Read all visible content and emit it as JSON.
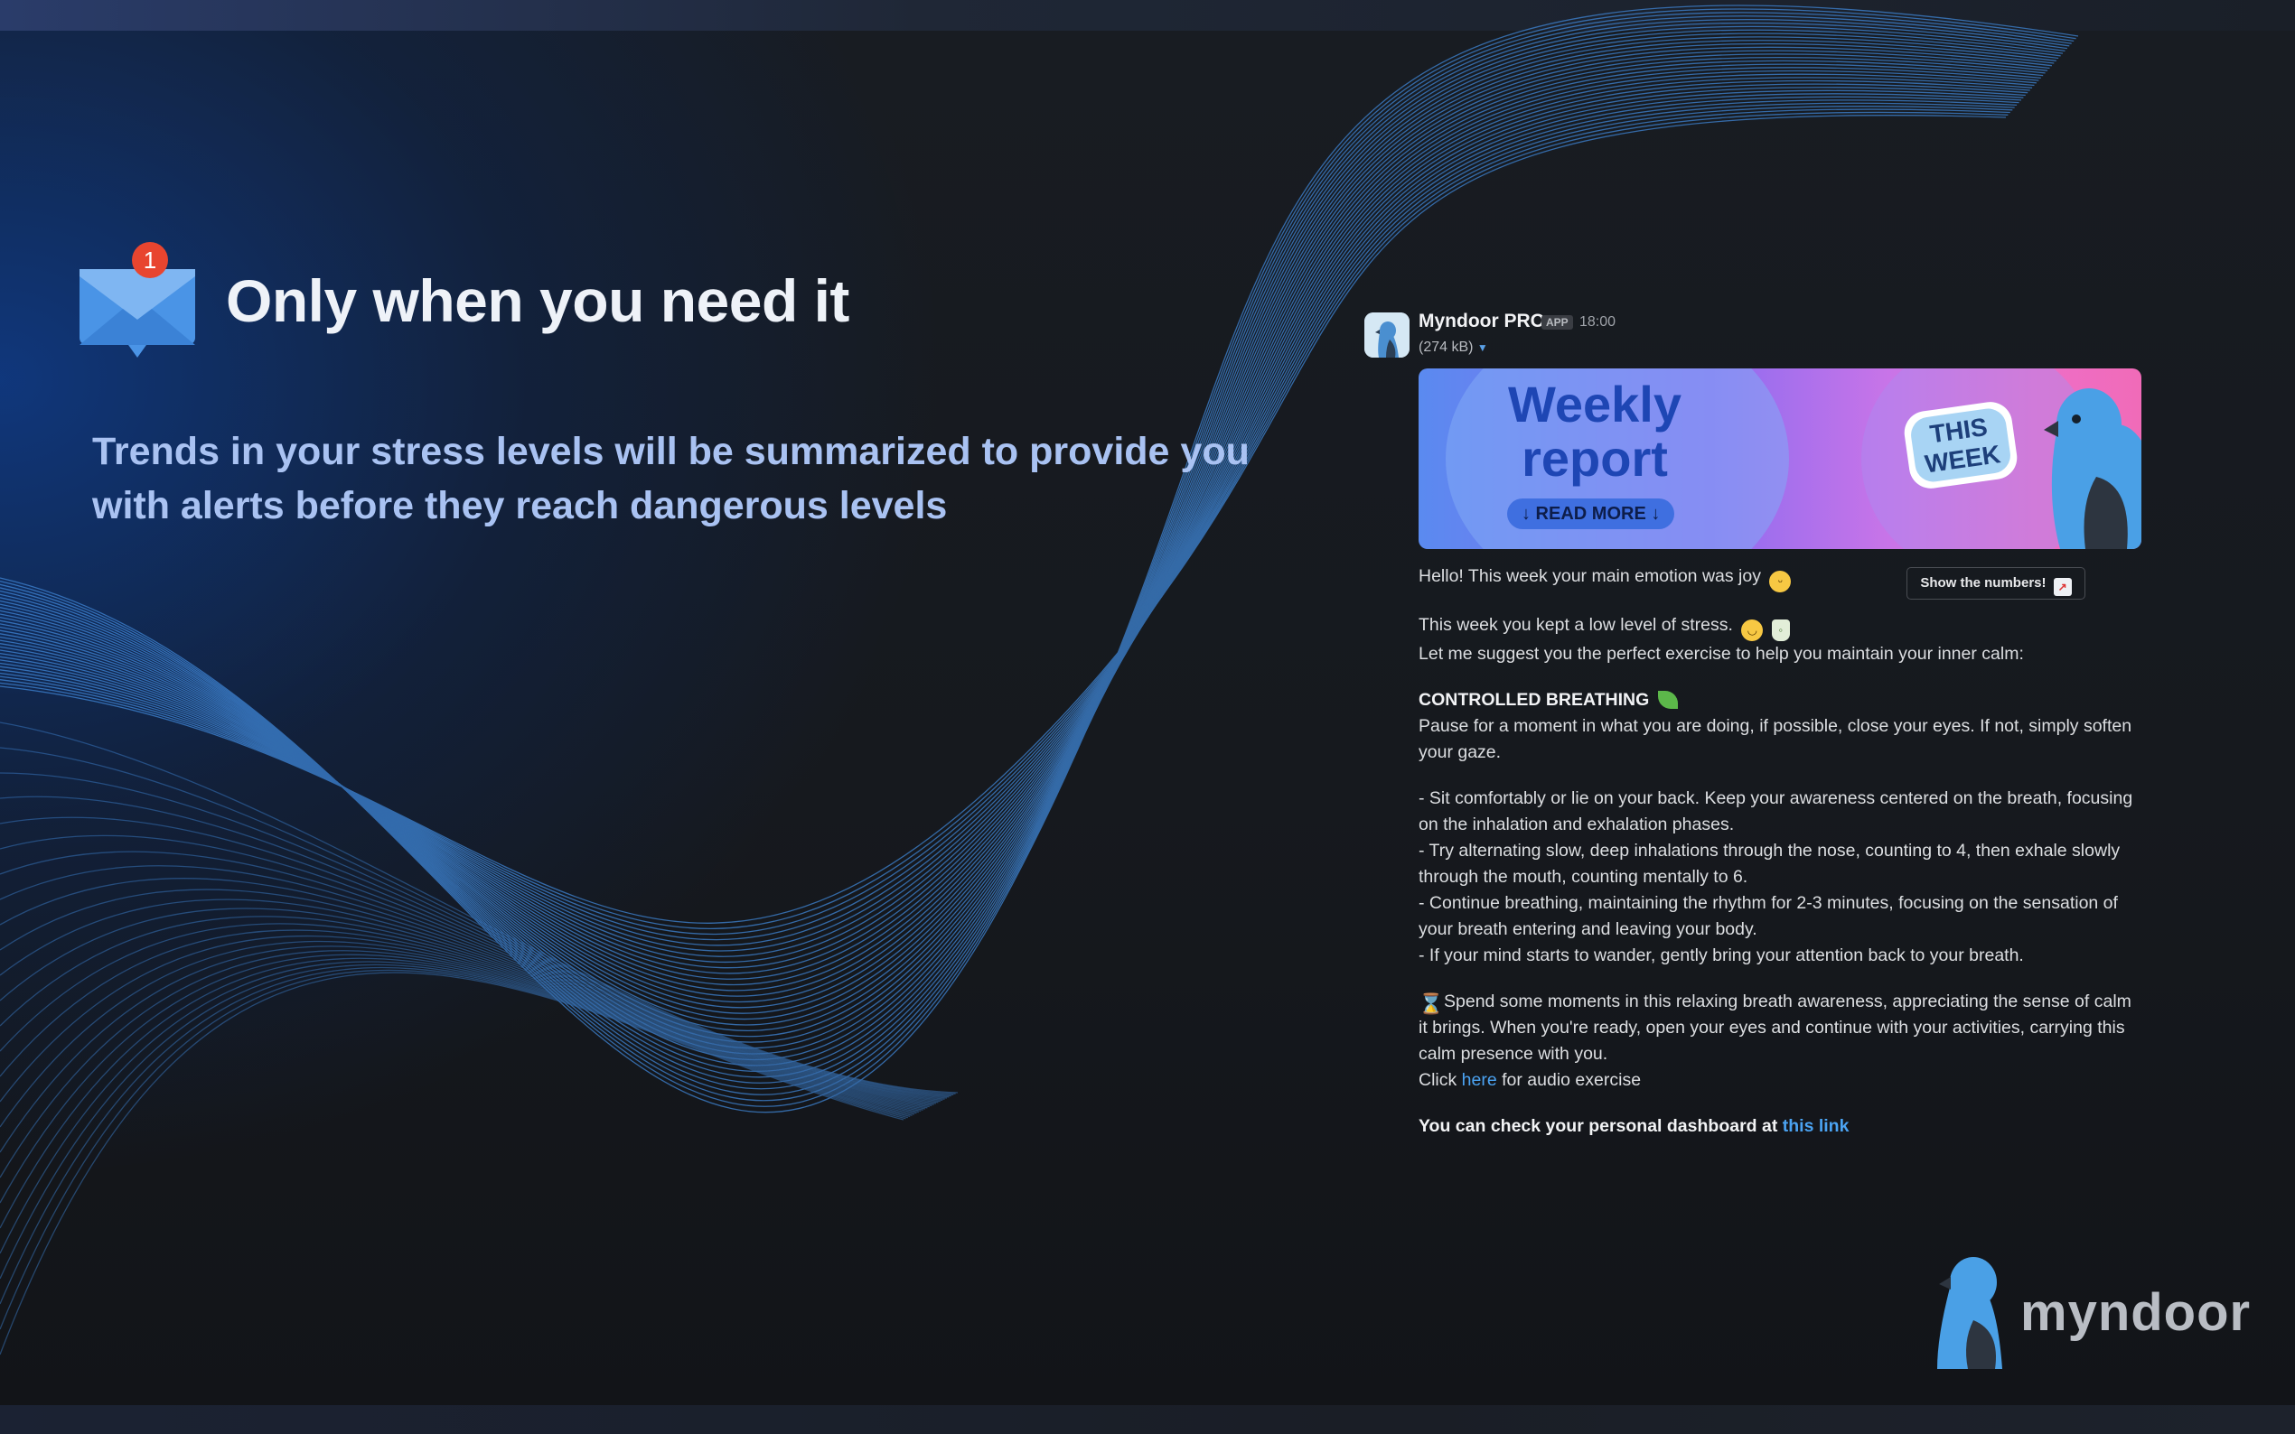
{
  "hero": {
    "badge_count": "1",
    "headline": "Only when you need it",
    "subline": "Trends in your stress levels will be summarized to provide you with alerts before they reach dangerous levels"
  },
  "message": {
    "sender": "Myndoor PRO",
    "app_tag": "APP",
    "time": "18:00",
    "attachment_size": "(274 kB)",
    "banner": {
      "title_line1": "Weekly",
      "title_line2": "report",
      "read_more": "↓ READ MORE ↓",
      "sticker_line1": "THIS",
      "sticker_line2": "WEEK"
    },
    "show_numbers_button": "Show the numbers!",
    "greeting": "Hello! This week your main emotion was joy",
    "stress_line": "This week you kept a low level of stress.",
    "suggest_line": "Let me suggest you the perfect exercise to help you maintain your inner calm:",
    "exercise_title": "CONTROLLED BREATHING",
    "exercise_intro": "Pause for a moment in what you are doing, if possible, close your eyes. If not, simply soften your gaze.",
    "steps": [
      "- Sit comfortably or lie on your back. Keep your awareness centered on the breath, focusing on the inhalation and exhalation phases.",
      "- Try alternating slow, deep inhalations through the nose, counting to 4, then exhale slowly through the mouth, counting mentally to 6.",
      "- Continue breathing, maintaining the rhythm for 2-3 minutes, focusing on the sensation of your breath entering and leaving your body.",
      "- If your mind starts to wander, gently bring your attention back to your breath."
    ],
    "closing": "Spend some moments in this relaxing breath awareness, appreciating the sense of calm it brings. When you're ready, open your eyes and continue with your activities, carrying this calm presence with you.",
    "audio_prefix": "Click",
    "audio_link": "here",
    "audio_suffix": "for audio exercise",
    "dashboard_prefix": "You can check your personal dashboard at",
    "dashboard_link": "this link"
  },
  "brand": {
    "logo_text": "myndoor"
  },
  "colors": {
    "accent_blue": "#4ba3f2",
    "headline_text": "#eef2f8",
    "subline_text": "#a9c2f2",
    "wave_blue": "#3f86d6",
    "badge_red": "#e8452f"
  },
  "icons": {
    "mail": "envelope-with-notification-icon",
    "avatar": "myndoor-bird-avatar-icon",
    "logo": "myndoor-bird-logo-icon"
  }
}
